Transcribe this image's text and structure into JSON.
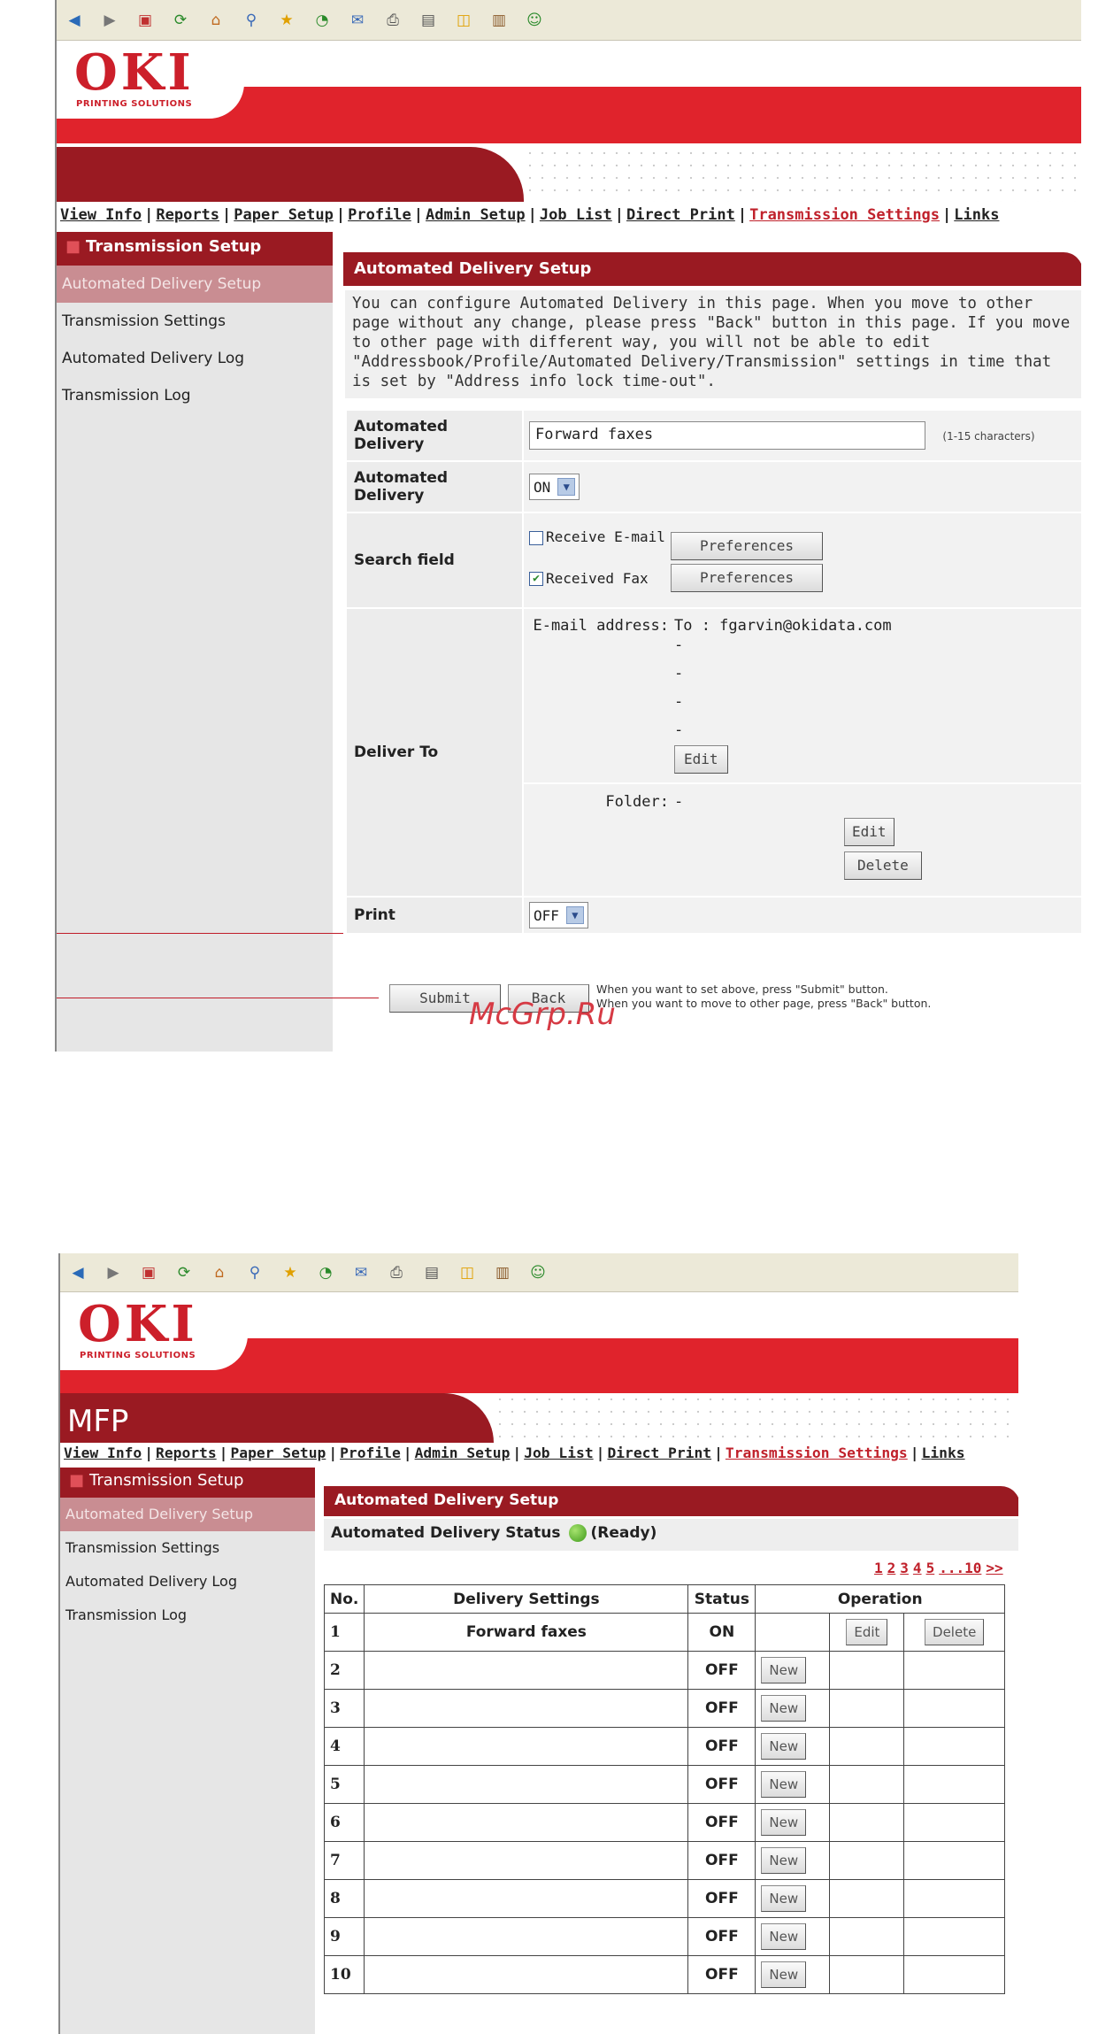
{
  "toolbar_icons": [
    "back-icon",
    "forward-icon",
    "stop-icon",
    "refresh-icon",
    "home-icon",
    "search-icon",
    "favorites-icon",
    "history-icon",
    "mail-icon",
    "print-icon",
    "edit-icon",
    "discuss-icon",
    "research-icon",
    "messenger-icon"
  ],
  "logo": {
    "text": "OKI",
    "subtitle": "PRINTING SOLUTIONS"
  },
  "nav": [
    "View Info",
    "Reports",
    "Paper Setup",
    "Profile",
    "Admin Setup",
    "Job List",
    "Direct Print",
    "Transmission Settings",
    "Links"
  ],
  "nav_active": "Transmission Settings",
  "sidebar": {
    "title": "Transmission Setup",
    "items": [
      "Automated Delivery Setup",
      "Transmission Settings",
      "Automated Delivery Log",
      "Transmission Log"
    ]
  },
  "screen1": {
    "panel_title": "Automated Delivery Setup",
    "description": "You can configure Automated Delivery in this page. When you move to other page without any change, please press \"Back\" button in this page. If you move to other page with different way, you will not be able to edit \"Addressbook/Profile/Automated Delivery/Transmission\" settings in time that is set by \"Address info lock time-out\".",
    "row_name_label": "Automated Delivery",
    "row_name_value": "Forward faxes",
    "row_name_hint": "(1-15 characters)",
    "row_onoff_label": "Automated Delivery",
    "row_onoff_value": "ON",
    "search_label": "Search field",
    "search_opt1": "Receive E-mail",
    "search_opt2": "Received Fax",
    "preferences": "Preferences",
    "deliver_label": "Deliver To",
    "email_label": "E-mail address:",
    "email_value": "To : fgarvin@okidata.com",
    "dash": "-",
    "folder_label": "Folder:",
    "edit": "Edit",
    "delete": "Delete",
    "print_label": "Print",
    "print_value": "OFF",
    "submit": "Submit",
    "back": "Back",
    "note1": "When you want to set above, press \"Submit\" button.",
    "note2": "When you want to move to other page, press \"Back\" button.",
    "watermark": "McGrp.Ru"
  },
  "screen2": {
    "mfp_label": "MFP",
    "panel_title": "Automated Delivery Setup",
    "status_label": "Automated Delivery Status",
    "status_value": "(Ready)",
    "pager": [
      "1",
      "2",
      "3",
      "4",
      "5",
      "...10",
      ">>"
    ],
    "headers": {
      "no": "No.",
      "settings": "Delivery Settings",
      "status": "Status",
      "operation": "Operation"
    },
    "rows": [
      {
        "no": "1",
        "name": "Forward faxes",
        "status": "ON"
      },
      {
        "no": "2",
        "name": "",
        "status": "OFF"
      },
      {
        "no": "3",
        "name": "",
        "status": "OFF"
      },
      {
        "no": "4",
        "name": "",
        "status": "OFF"
      },
      {
        "no": "5",
        "name": "",
        "status": "OFF"
      },
      {
        "no": "6",
        "name": "",
        "status": "OFF"
      },
      {
        "no": "7",
        "name": "",
        "status": "OFF"
      },
      {
        "no": "8",
        "name": "",
        "status": "OFF"
      },
      {
        "no": "9",
        "name": "",
        "status": "OFF"
      },
      {
        "no": "10",
        "name": "",
        "status": "OFF"
      }
    ],
    "new": "New",
    "edit": "Edit",
    "delete": "Delete"
  }
}
